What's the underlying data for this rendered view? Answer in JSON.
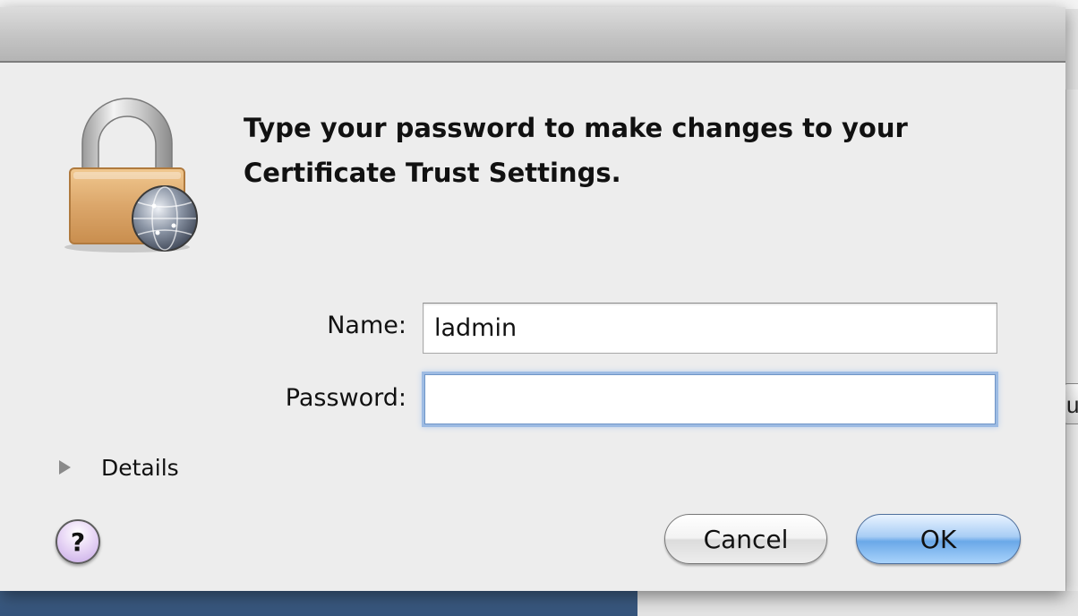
{
  "dialog": {
    "message": "Type your password to make changes to your Certificate Trust Settings.",
    "icon": "lock-globe-icon"
  },
  "form": {
    "name_label": "Name:",
    "name_value": "ladmin",
    "password_label": "Password:",
    "password_value": ""
  },
  "details": {
    "label": "Details",
    "expanded": false
  },
  "buttons": {
    "help_label": "?",
    "cancel_label": "Cancel",
    "ok_label": "OK"
  },
  "background": {
    "partial_button_label": "u"
  },
  "colors": {
    "default_button": "#6aa8e8",
    "focus_ring": "#9dbbe3",
    "help_button": "#c6a8e6"
  }
}
